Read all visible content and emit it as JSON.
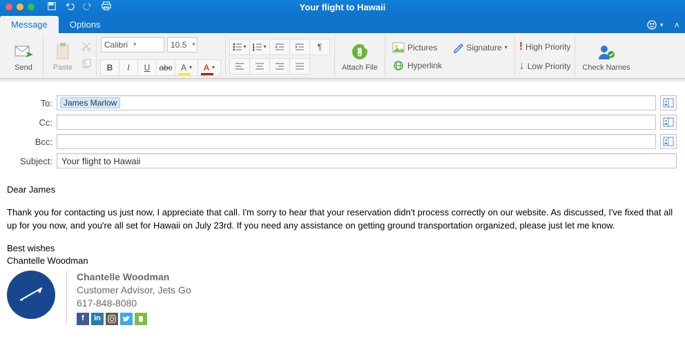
{
  "window": {
    "title": "Your flight to Hawaii"
  },
  "tabs": {
    "message": "Message",
    "options": "Options"
  },
  "ribbon": {
    "send": "Send",
    "paste": "Paste",
    "font_name": "Calibri",
    "font_size": "10.5",
    "attach": "Attach File",
    "pictures": "Pictures",
    "signature": "Signature",
    "hyperlink": "Hyperlink",
    "high_priority": "High Priority",
    "low_priority": "Low Priority",
    "check_names": "Check Names"
  },
  "addr": {
    "to_label": "To:",
    "cc_label": "Cc:",
    "bcc_label": "Bcc:",
    "subject_label": "Subject:",
    "to_recipient": "James Marlow",
    "cc": "",
    "bcc": "",
    "subject": "Your flight to Hawaii"
  },
  "body": {
    "greeting": "Dear James",
    "para": "Thank you for contacting us just now, I appreciate that call. I'm sorry to hear that your reservation didn't process correctly on our website. As discussed, I've fixed that all up for you now, and you're all set for Hawaii on July 23rd. If you need any assistance on getting ground transportation organized, please just let me know.",
    "closing1": "Best wishes",
    "closing2": "Chantelle Woodman"
  },
  "signature": {
    "name": "Chantelle Woodman",
    "title": "Customer Advisor, Jets Go",
    "phone": "617-848-8080"
  }
}
